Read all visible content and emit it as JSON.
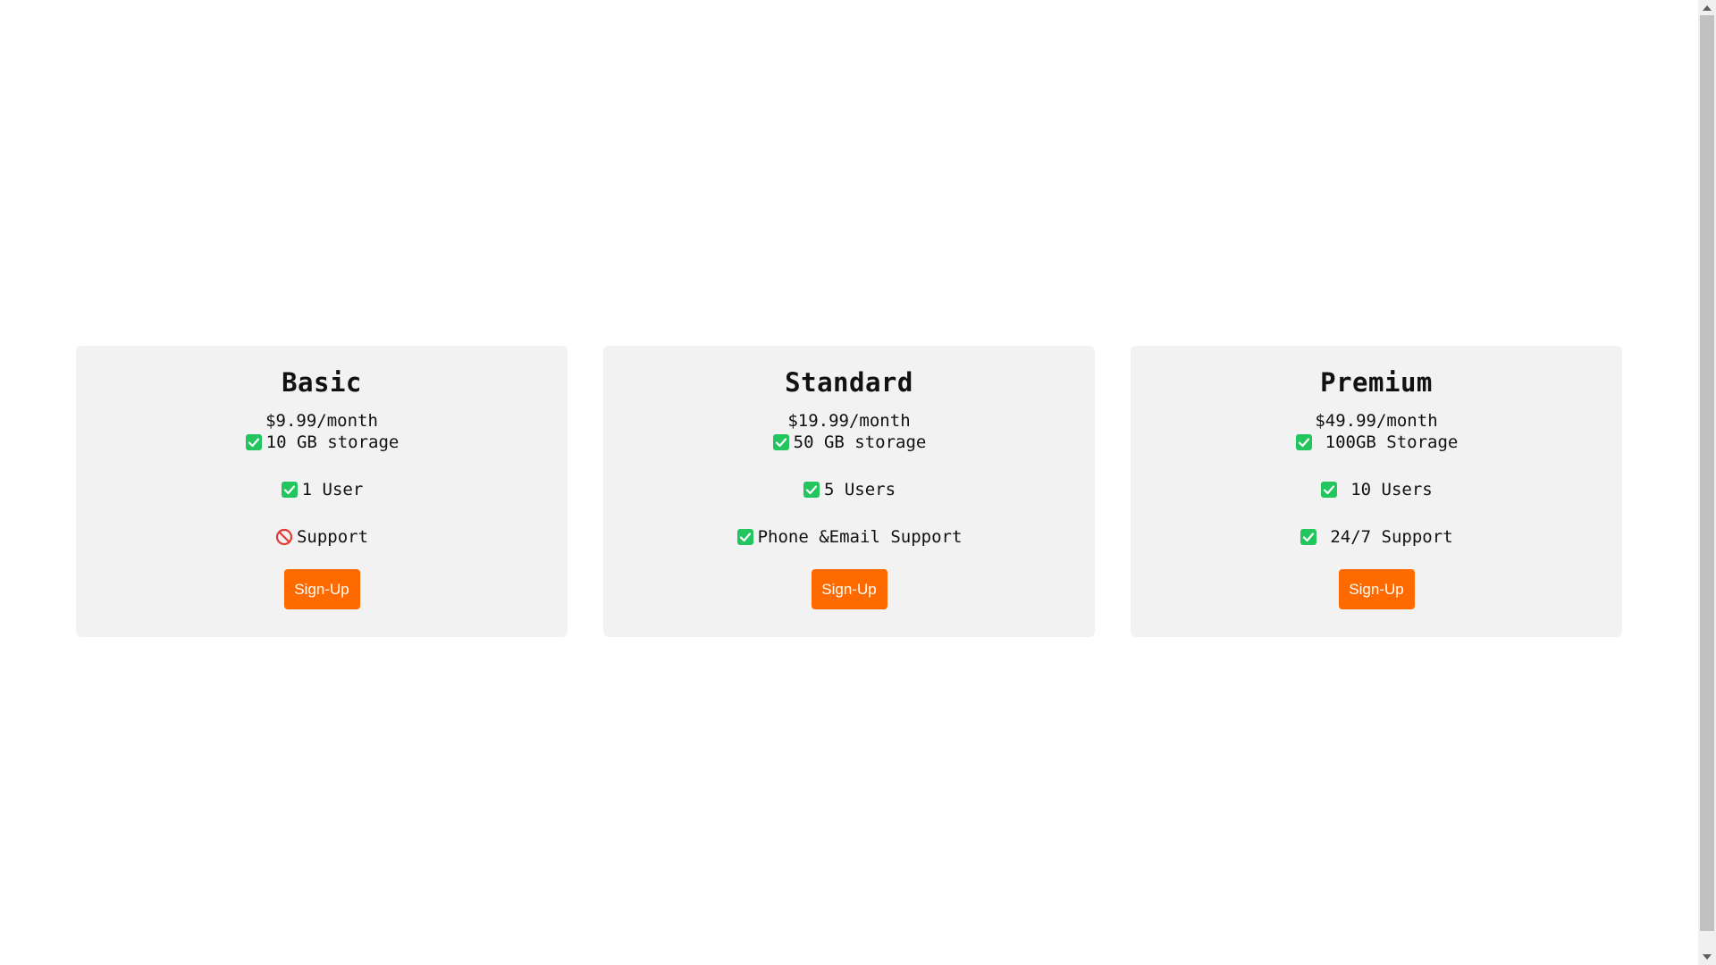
{
  "plans": [
    {
      "name": "Basic",
      "price": "$9.99/month",
      "features": [
        {
          "icon": "check-icon",
          "text": "10 GB storage"
        },
        {
          "icon": "check-icon",
          "text": "1 User"
        },
        {
          "icon": "prohibited-icon",
          "text": "Support"
        }
      ],
      "button_label": "Sign-Up"
    },
    {
      "name": "Standard",
      "price": "$19.99/month",
      "features": [
        {
          "icon": "check-icon",
          "text": "50 GB storage"
        },
        {
          "icon": "check-icon",
          "text": "5 Users"
        },
        {
          "icon": "check-icon",
          "text": "Phone &Email Support"
        }
      ],
      "button_label": "Sign-Up"
    },
    {
      "name": "Premium",
      "price": "$49.99/month",
      "features": [
        {
          "icon": "check-icon",
          "text": "100GB Storage"
        },
        {
          "icon": "check-icon",
          "text": "10 Users"
        },
        {
          "icon": "check-icon",
          "text": "24/7 Support"
        }
      ],
      "button_label": "Sign-Up"
    }
  ],
  "colors": {
    "card_background": "#f2f2f2",
    "button": "#ff6a00",
    "check": "#22c55e",
    "prohibited": "#e53935"
  }
}
